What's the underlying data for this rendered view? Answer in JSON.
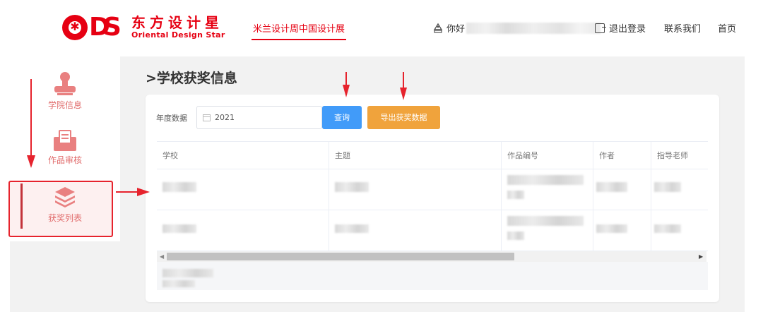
{
  "header": {
    "logo_cn": "东方设计星",
    "logo_en": "Oriental Design Star",
    "nav_main": "米兰设计周中国设计展",
    "user_greeting": "你好",
    "logout_label": "退出登录",
    "contact_label": "联系我们",
    "home_label": "首页"
  },
  "sidebar": {
    "items": [
      {
        "label": "学院信息",
        "icon": "stamp-icon"
      },
      {
        "label": "作品审核",
        "icon": "mail-document-icon"
      },
      {
        "label": "获奖列表",
        "icon": "layers-icon",
        "active": true
      }
    ]
  },
  "main": {
    "title": ">学校获奖信息",
    "year_label": "年度数据",
    "year_value": "2021",
    "query_button": "查询",
    "export_button": "导出获奖数据"
  },
  "table": {
    "columns": [
      "学校",
      "主题",
      "作品编号",
      "作者",
      "指导老师"
    ]
  },
  "colors": {
    "brand_red": "#e60012",
    "sidebar_pink": "#e98080",
    "query_blue": "#419bf9",
    "export_orange": "#f0a33c",
    "annotation_red": "#e6232d"
  }
}
